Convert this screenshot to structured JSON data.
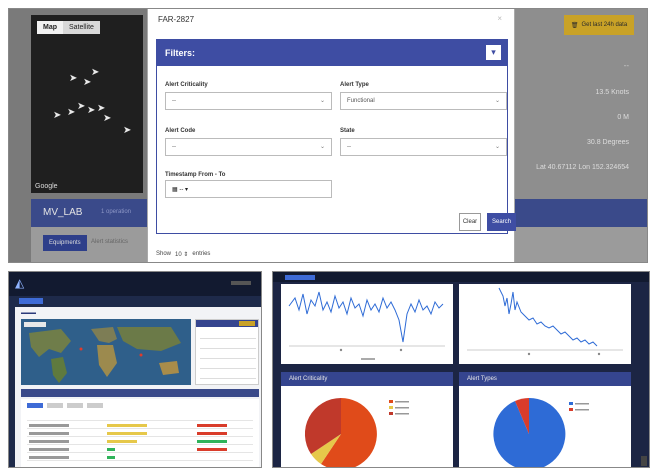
{
  "top": {
    "map": {
      "tab_map": "Map",
      "tab_satellite": "Satellite",
      "google": "Google"
    },
    "modal": {
      "title": "FAR-2827",
      "filters_title": "Filters:",
      "collapse_icon": "chevron-down-icon",
      "fields": {
        "alert_criticality": {
          "label": "Alert Criticality",
          "value": "--"
        },
        "alert_type": {
          "label": "Alert Type",
          "value": "Functional"
        },
        "alert_code": {
          "label": "Alert Code",
          "value": "--"
        },
        "state": {
          "label": "State",
          "value": "--"
        },
        "timestamp": {
          "label": "Timestamp From - To",
          "value": "-- ▾"
        }
      },
      "clear_label": "Clear",
      "search_label": "Search",
      "show": {
        "prefix": "Show",
        "value": "10 ⇕",
        "suffix": "entries"
      }
    },
    "right": {
      "button_label": "Get last 24h data",
      "dash": "--",
      "values": [
        "13.5 Knots",
        "0 M",
        "30.8 Degrees",
        "Lat 40.67112 Lon 152.324654"
      ]
    },
    "lab": {
      "title": "MV_LAB",
      "sub": "1 operation"
    },
    "tabs": {
      "equipments": "Equipments",
      "alert_statistics": "Alert statistics"
    }
  },
  "bottom_right": {
    "alert_criticality_title": "Alert Criticality",
    "alert_types_title": "Alert Types",
    "legend_colors": {
      "criticality": [
        "#e04b1a",
        "#e6c84a",
        "#c0392b"
      ],
      "types": [
        "#2e6bd6",
        "#d93c2a"
      ]
    }
  },
  "colors": {
    "accent": "#3e4da3",
    "nav": "#1e2a4a",
    "warning": "#c9a227"
  }
}
